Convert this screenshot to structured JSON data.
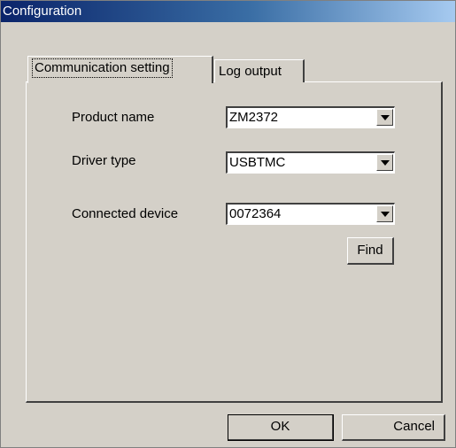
{
  "window": {
    "title": "Configuration"
  },
  "tabs": [
    {
      "label": "Communication setting",
      "active": true
    },
    {
      "label": "Log output",
      "active": false
    }
  ],
  "form": {
    "product_name": {
      "label": "Product name",
      "value": "ZM2372"
    },
    "driver_type": {
      "label": "Driver type",
      "value": "USBTMC"
    },
    "connected_device": {
      "label": "Connected device",
      "value": "0072364"
    },
    "find_label": "Find"
  },
  "footer": {
    "ok_label": "OK",
    "cancel_label": "Cancel"
  },
  "colors": {
    "face": "#d4d0c8",
    "titlebar_start": "#0a246a",
    "titlebar_end": "#a6caf0",
    "field": "#ffffff"
  },
  "icons": {
    "dropdown": "chevron-down-icon"
  }
}
